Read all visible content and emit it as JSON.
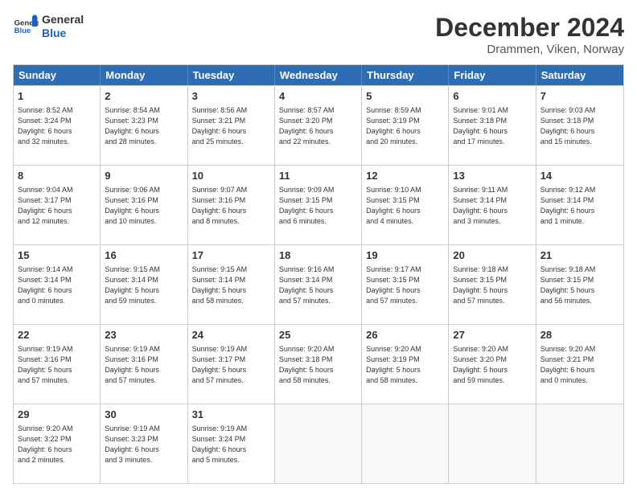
{
  "header": {
    "logo_general": "General",
    "logo_blue": "Blue",
    "month": "December 2024",
    "location": "Drammen, Viken, Norway"
  },
  "days_of_week": [
    "Sunday",
    "Monday",
    "Tuesday",
    "Wednesday",
    "Thursday",
    "Friday",
    "Saturday"
  ],
  "weeks": [
    [
      {
        "day": "1",
        "text": "Sunrise: 8:52 AM\nSunset: 3:24 PM\nDaylight: 6 hours\nand 32 minutes."
      },
      {
        "day": "2",
        "text": "Sunrise: 8:54 AM\nSunset: 3:23 PM\nDaylight: 6 hours\nand 28 minutes."
      },
      {
        "day": "3",
        "text": "Sunrise: 8:56 AM\nSunset: 3:21 PM\nDaylight: 6 hours\nand 25 minutes."
      },
      {
        "day": "4",
        "text": "Sunrise: 8:57 AM\nSunset: 3:20 PM\nDaylight: 6 hours\nand 22 minutes."
      },
      {
        "day": "5",
        "text": "Sunrise: 8:59 AM\nSunset: 3:19 PM\nDaylight: 6 hours\nand 20 minutes."
      },
      {
        "day": "6",
        "text": "Sunrise: 9:01 AM\nSunset: 3:18 PM\nDaylight: 6 hours\nand 17 minutes."
      },
      {
        "day": "7",
        "text": "Sunrise: 9:03 AM\nSunset: 3:18 PM\nDaylight: 6 hours\nand 15 minutes."
      }
    ],
    [
      {
        "day": "8",
        "text": "Sunrise: 9:04 AM\nSunset: 3:17 PM\nDaylight: 6 hours\nand 12 minutes."
      },
      {
        "day": "9",
        "text": "Sunrise: 9:06 AM\nSunset: 3:16 PM\nDaylight: 6 hours\nand 10 minutes."
      },
      {
        "day": "10",
        "text": "Sunrise: 9:07 AM\nSunset: 3:16 PM\nDaylight: 6 hours\nand 8 minutes."
      },
      {
        "day": "11",
        "text": "Sunrise: 9:09 AM\nSunset: 3:15 PM\nDaylight: 6 hours\nand 6 minutes."
      },
      {
        "day": "12",
        "text": "Sunrise: 9:10 AM\nSunset: 3:15 PM\nDaylight: 6 hours\nand 4 minutes."
      },
      {
        "day": "13",
        "text": "Sunrise: 9:11 AM\nSunset: 3:14 PM\nDaylight: 6 hours\nand 3 minutes."
      },
      {
        "day": "14",
        "text": "Sunrise: 9:12 AM\nSunset: 3:14 PM\nDaylight: 6 hours\nand 1 minute."
      }
    ],
    [
      {
        "day": "15",
        "text": "Sunrise: 9:14 AM\nSunset: 3:14 PM\nDaylight: 6 hours\nand 0 minutes."
      },
      {
        "day": "16",
        "text": "Sunrise: 9:15 AM\nSunset: 3:14 PM\nDaylight: 5 hours\nand 59 minutes."
      },
      {
        "day": "17",
        "text": "Sunrise: 9:15 AM\nSunset: 3:14 PM\nDaylight: 5 hours\nand 58 minutes."
      },
      {
        "day": "18",
        "text": "Sunrise: 9:16 AM\nSunset: 3:14 PM\nDaylight: 5 hours\nand 57 minutes."
      },
      {
        "day": "19",
        "text": "Sunrise: 9:17 AM\nSunset: 3:15 PM\nDaylight: 5 hours\nand 57 minutes."
      },
      {
        "day": "20",
        "text": "Sunrise: 9:18 AM\nSunset: 3:15 PM\nDaylight: 5 hours\nand 57 minutes."
      },
      {
        "day": "21",
        "text": "Sunrise: 9:18 AM\nSunset: 3:15 PM\nDaylight: 5 hours\nand 56 minutes."
      }
    ],
    [
      {
        "day": "22",
        "text": "Sunrise: 9:19 AM\nSunset: 3:16 PM\nDaylight: 5 hours\nand 57 minutes."
      },
      {
        "day": "23",
        "text": "Sunrise: 9:19 AM\nSunset: 3:16 PM\nDaylight: 5 hours\nand 57 minutes."
      },
      {
        "day": "24",
        "text": "Sunrise: 9:19 AM\nSunset: 3:17 PM\nDaylight: 5 hours\nand 57 minutes."
      },
      {
        "day": "25",
        "text": "Sunrise: 9:20 AM\nSunset: 3:18 PM\nDaylight: 5 hours\nand 58 minutes."
      },
      {
        "day": "26",
        "text": "Sunrise: 9:20 AM\nSunset: 3:19 PM\nDaylight: 5 hours\nand 58 minutes."
      },
      {
        "day": "27",
        "text": "Sunrise: 9:20 AM\nSunset: 3:20 PM\nDaylight: 5 hours\nand 59 minutes."
      },
      {
        "day": "28",
        "text": "Sunrise: 9:20 AM\nSunset: 3:21 PM\nDaylight: 6 hours\nand 0 minutes."
      }
    ],
    [
      {
        "day": "29",
        "text": "Sunrise: 9:20 AM\nSunset: 3:22 PM\nDaylight: 6 hours\nand 2 minutes."
      },
      {
        "day": "30",
        "text": "Sunrise: 9:19 AM\nSunset: 3:23 PM\nDaylight: 6 hours\nand 3 minutes."
      },
      {
        "day": "31",
        "text": "Sunrise: 9:19 AM\nSunset: 3:24 PM\nDaylight: 6 hours\nand 5 minutes."
      },
      {
        "day": "",
        "text": ""
      },
      {
        "day": "",
        "text": ""
      },
      {
        "day": "",
        "text": ""
      },
      {
        "day": "",
        "text": ""
      }
    ]
  ]
}
